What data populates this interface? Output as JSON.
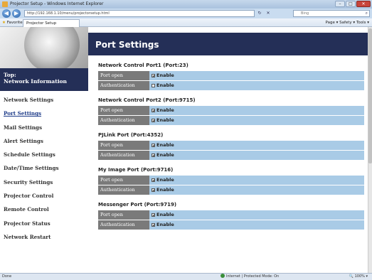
{
  "window": {
    "title": "Projector Setup - Windows Internet Explorer",
    "controls": [
      "–",
      "□",
      "✕"
    ]
  },
  "address": {
    "url": "http://192.168.1.10/menu/projectorsetup.html",
    "search_placeholder": "Bing",
    "tools": [
      "↻",
      "✕"
    ]
  },
  "favorites": {
    "favorites_label": "Favorites",
    "tab_label": "Projector Setup",
    "commands": "Page ▾  Safety ▾  Tools ▾"
  },
  "sidebar": {
    "top_title": "Top:",
    "top_subtitle": "Network Information",
    "items": [
      {
        "label": "Network Settings"
      },
      {
        "label": "Port Settings"
      },
      {
        "label": "Mail Settings"
      },
      {
        "label": "Alert Settings"
      },
      {
        "label": "Schedule Settings"
      },
      {
        "label": "Date/Time Settings"
      },
      {
        "label": "Security Settings"
      },
      {
        "label": "Projector Control"
      },
      {
        "label": "Remote Control"
      },
      {
        "label": "Projector Status"
      },
      {
        "label": "Network Restart"
      }
    ],
    "active_item": "Port Settings"
  },
  "main": {
    "title": "Port Settings",
    "sections": [
      {
        "title": "Network Control Port1 (Port:23)",
        "rows": [
          {
            "label": "Port open",
            "value": "Enable",
            "checked": true
          },
          {
            "label": "Authentication",
            "value": "Enable",
            "checked": false
          }
        ]
      },
      {
        "title": "Network Control Port2 (Port:9715)",
        "rows": [
          {
            "label": "Port open",
            "value": "Enable",
            "checked": true
          },
          {
            "label": "Authentication",
            "value": "Enable",
            "checked": true
          }
        ]
      },
      {
        "title": "PJLink Port (Port:4352)",
        "rows": [
          {
            "label": "Port open",
            "value": "Enable",
            "checked": true
          },
          {
            "label": "Authentication",
            "value": "Enable",
            "checked": true
          }
        ]
      },
      {
        "title": "My Image Port (Port:9716)",
        "rows": [
          {
            "label": "Port open",
            "value": "Enable",
            "checked": true
          },
          {
            "label": "Authentication",
            "value": "Enable",
            "checked": true
          }
        ]
      },
      {
        "title": "Messenger Port (Port:9719)",
        "rows": [
          {
            "label": "Port open",
            "value": "Enable",
            "checked": true
          },
          {
            "label": "Authentication",
            "value": "Enable",
            "checked": true
          }
        ]
      }
    ]
  },
  "status": {
    "left": "Done",
    "zone": "Internet | Protected Mode: On",
    "zoom": "100%"
  },
  "colors": {
    "nav_dark": "#242f57",
    "row_label_bg": "#7a7a7a",
    "row_value_bg": "#a9cbe6"
  }
}
